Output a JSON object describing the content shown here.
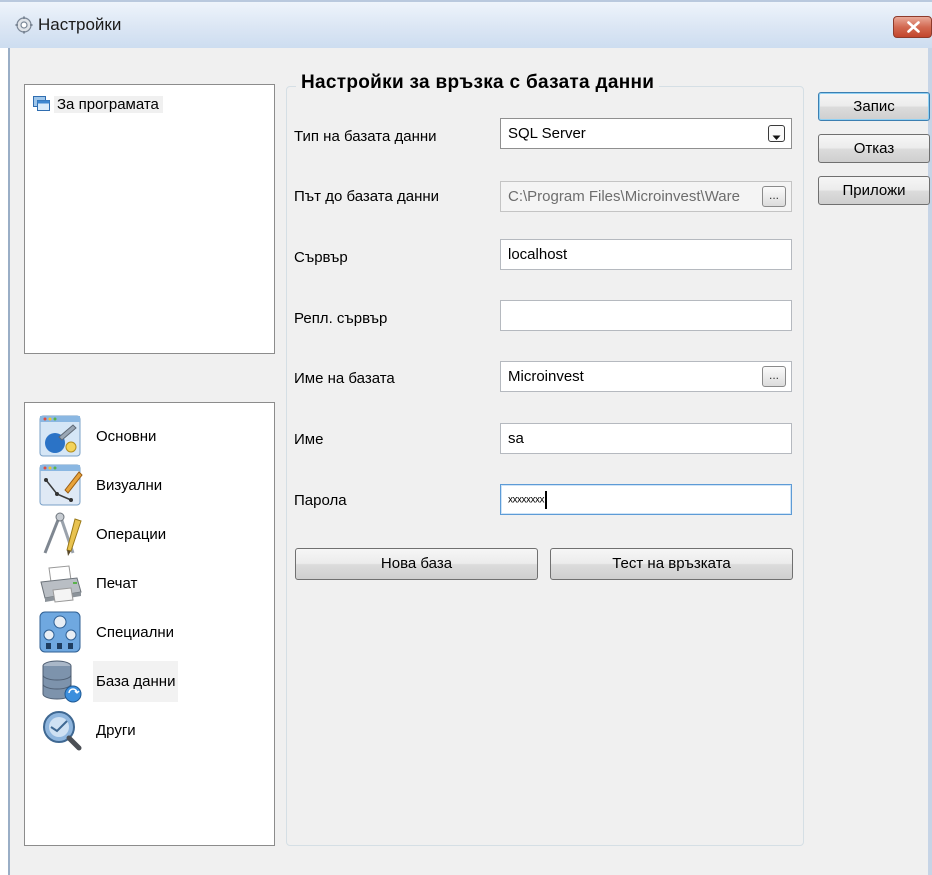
{
  "window": {
    "title": "Настройки",
    "icon": "gear-icon",
    "close_icon": "close-icon"
  },
  "about_tree": {
    "item_label": "За програмата",
    "item_icon": "windows-icon"
  },
  "nav": {
    "items": [
      {
        "label": "Основни",
        "icon": "general-settings-icon"
      },
      {
        "label": "Визуални",
        "icon": "visual-settings-icon"
      },
      {
        "label": "Операции",
        "icon": "operations-icon"
      },
      {
        "label": "Печат",
        "icon": "printer-icon"
      },
      {
        "label": "Специални",
        "icon": "special-settings-icon"
      },
      {
        "label": "База данни",
        "icon": "database-icon",
        "selected": true
      },
      {
        "label": "Други",
        "icon": "other-icon"
      }
    ]
  },
  "db_settings": {
    "group_title": "Настройки за връзка с базата данни",
    "db_type": {
      "label": "Тип на базата данни",
      "value": "SQL Server"
    },
    "db_path": {
      "label": "Път до базата данни",
      "value": "C:\\Program Files\\Microinvest\\Ware",
      "button_label": "..."
    },
    "server": {
      "label": "Сървър",
      "value": "localhost"
    },
    "repl_server": {
      "label": "Репл. сървър",
      "value": ""
    },
    "db_name": {
      "label": "Име на базата",
      "value": "Microinvest",
      "button_label": "..."
    },
    "user": {
      "label": "Име",
      "value": "sa"
    },
    "password": {
      "label": "Парола",
      "value": "xxxxxxxx"
    },
    "new_db_button": "Нова база",
    "test_button": "Тест на връзката"
  },
  "dialog_buttons": {
    "save": "Запис",
    "cancel": "Отказ",
    "apply": "Приложи"
  },
  "colors": {
    "accent": "#3c7fb1",
    "client_bg": "#f0f0f0",
    "close_red": "#c2452c"
  }
}
